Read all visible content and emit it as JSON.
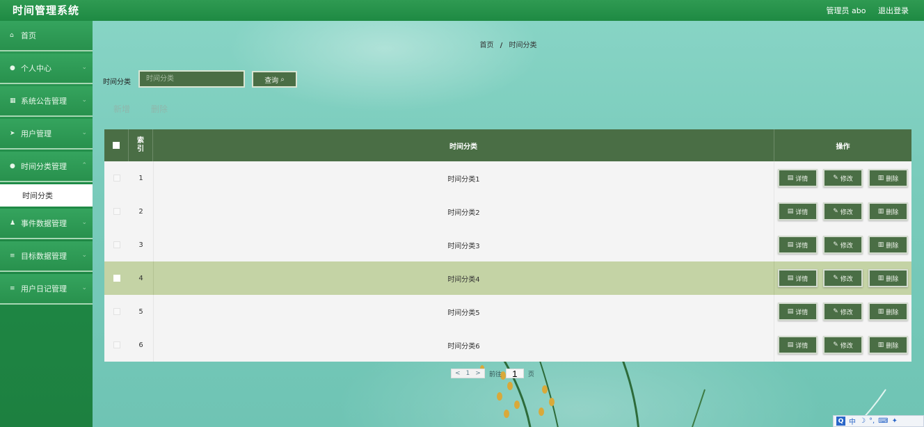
{
  "app": {
    "title": "时间管理系统"
  },
  "topbar": {
    "user": "管理员 abo",
    "logout": "退出登录"
  },
  "sidebar": {
    "items": [
      {
        "label": "首页",
        "icon": "home-icon",
        "glyph": "⌂"
      },
      {
        "label": "个人中心",
        "icon": "user-icon",
        "glyph": "●"
      },
      {
        "label": "系统公告管理",
        "icon": "grid-icon",
        "glyph": "▦"
      },
      {
        "label": "用户管理",
        "icon": "send-icon",
        "glyph": "➤"
      },
      {
        "label": "时间分类管理",
        "icon": "dot-icon",
        "glyph": "●"
      },
      {
        "label": "事件数据管理",
        "icon": "person-icon",
        "glyph": "♟"
      },
      {
        "label": "目标数据管理",
        "icon": "list-icon",
        "glyph": "≡"
      },
      {
        "label": "用户日记管理",
        "icon": "menu-icon",
        "glyph": "≡"
      }
    ],
    "sub_item": "时间分类"
  },
  "breadcrumb": {
    "home": "首页",
    "separator": "/",
    "current": "时间分类"
  },
  "search": {
    "label": "时间分类",
    "placeholder": "时间分类",
    "button": "查询"
  },
  "actions": {
    "add": "新增",
    "delete": "删除"
  },
  "table": {
    "headers": {
      "index": "索引",
      "category": "时间分类",
      "operations": "操作"
    },
    "rows": [
      {
        "index": "1",
        "category": "时间分类1"
      },
      {
        "index": "2",
        "category": "时间分类2"
      },
      {
        "index": "3",
        "category": "时间分类3"
      },
      {
        "index": "4",
        "category": "时间分类4"
      },
      {
        "index": "5",
        "category": "时间分类5"
      },
      {
        "index": "6",
        "category": "时间分类6"
      }
    ],
    "op_labels": {
      "detail": "详情",
      "edit": "修改",
      "delete": "删除"
    }
  },
  "pagination": {
    "current_page": "1",
    "goto_label": "前往",
    "goto_value": "1",
    "page_unit": "页"
  },
  "ime": {
    "label": "中"
  },
  "colors": {
    "topbar": "#2f9a52",
    "sidebar": "#28914d",
    "table_header": "#4a6e45",
    "row_highlight": "#c4d3a5"
  }
}
